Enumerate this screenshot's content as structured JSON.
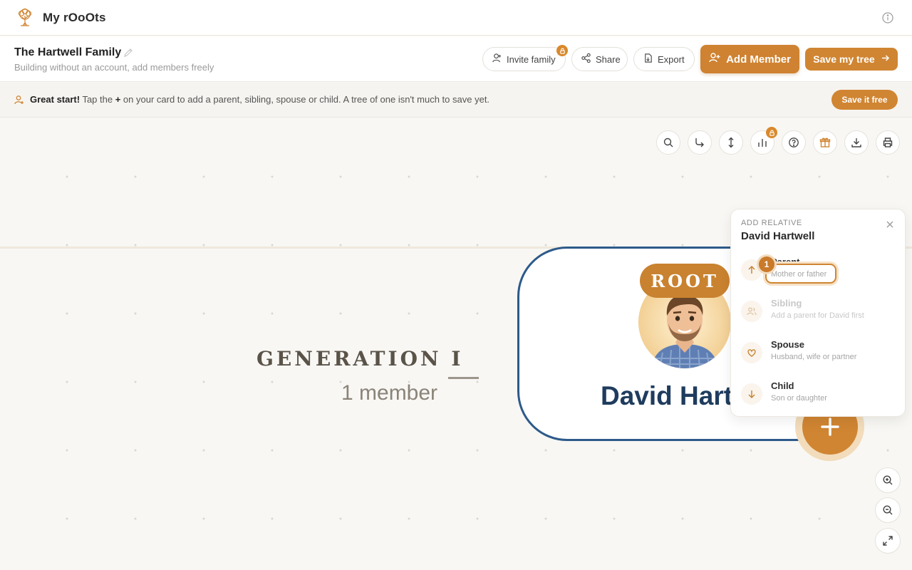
{
  "app": {
    "name": "My rOoOts",
    "icons": [
      "tree-logo-icon",
      "info-icon"
    ]
  },
  "family": {
    "name": "The Hartwell Family",
    "subtitle": "Building without an account, add members freely"
  },
  "header_actions": {
    "invite": "Invite family",
    "share": "Share",
    "export": "Export",
    "add_member": "Add Member",
    "save_tree": "Save my tree"
  },
  "hint": {
    "lead": "Great start!",
    "text_before": " Tap the ",
    "plus": "+",
    "text_after": " on your card to add a parent, sibling, spouse or child. A tree of one isn't much to save yet.",
    "cta": "Save it free"
  },
  "toolbar": [
    "search-icon",
    "redirect-icon",
    "vertical-layout-icon",
    "chart-icon",
    "help-icon",
    "gift-icon",
    "download-icon",
    "print-icon"
  ],
  "generation": {
    "title": "GENERATION I",
    "count": "1 member"
  },
  "member": {
    "badge": "ROOT",
    "name": "David Hartwell"
  },
  "popover": {
    "kicker": "ADD RELATIVE",
    "title": "David Hartwell",
    "step": "1",
    "options": [
      {
        "label": "Parent",
        "sub": "Mother or father",
        "enabled": true
      },
      {
        "label": "Sibling",
        "sub": "Add a parent for David first",
        "enabled": false
      },
      {
        "label": "Spouse",
        "sub": "Husband, wife or partner",
        "enabled": true
      },
      {
        "label": "Child",
        "sub": "Son or daughter",
        "enabled": true
      }
    ]
  },
  "colors": {
    "accent": "#d08532",
    "card_border": "#2d5a8a",
    "name": "#1f3c5e",
    "canvas": "#f8f7f4"
  }
}
